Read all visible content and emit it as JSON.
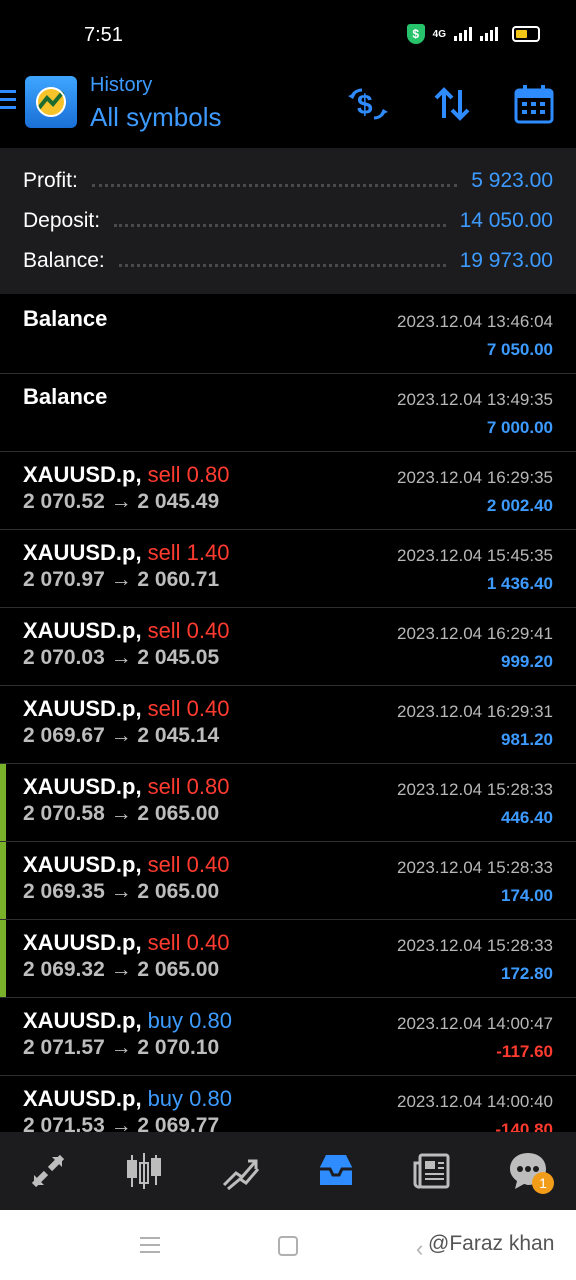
{
  "status": {
    "time": "7:51",
    "network": "4G",
    "shield_glyph": "$"
  },
  "header": {
    "subtitle": "History",
    "title": "All symbols",
    "actions": [
      "currency-exchange-icon",
      "sort-icon",
      "calendar-icon"
    ],
    "accent_color": "#3d9bff"
  },
  "summary": {
    "profit_label": "Profit:",
    "profit_value": "5 923.00",
    "deposit_label": "Deposit:",
    "deposit_value": "14 050.00",
    "balance_label": "Balance:",
    "balance_value": "19 973.00"
  },
  "deals": [
    {
      "kind": "balance",
      "title": "Balance",
      "date": "2023.12.04 13:46:04",
      "profit": "7 050.00"
    },
    {
      "kind": "balance",
      "title": "Balance",
      "date": "2023.12.04 13:49:35",
      "profit": "7 000.00"
    },
    {
      "kind": "trade",
      "symbol": "XAUUSD.p,",
      "side": "sell 0.80",
      "prices": "2 070.52 → 2 045.49",
      "date": "2023.12.04 16:29:35",
      "profit": "2 002.40"
    },
    {
      "kind": "trade",
      "symbol": "XAUUSD.p,",
      "side": "sell 1.40",
      "prices": "2 070.97 → 2 060.71",
      "date": "2023.12.04 15:45:35",
      "profit": "1 436.40"
    },
    {
      "kind": "trade",
      "symbol": "XAUUSD.p,",
      "side": "sell 0.40",
      "prices": "2 070.03 → 2 045.05",
      "date": "2023.12.04 16:29:41",
      "profit": "999.20"
    },
    {
      "kind": "trade",
      "symbol": "XAUUSD.p,",
      "side": "sell 0.40",
      "prices": "2 069.67 → 2 045.14",
      "date": "2023.12.04 16:29:31",
      "profit": "981.20"
    },
    {
      "kind": "trade",
      "symbol": "XAUUSD.p,",
      "side": "sell 0.80",
      "prices": "2 070.58 → 2 065.00",
      "date": "2023.12.04 15:28:33",
      "profit": "446.40"
    },
    {
      "kind": "trade",
      "symbol": "XAUUSD.p,",
      "side": "sell 0.40",
      "prices": "2 069.35 → 2 065.00",
      "date": "2023.12.04 15:28:33",
      "profit": "174.00"
    },
    {
      "kind": "trade",
      "symbol": "XAUUSD.p,",
      "side": "sell 0.40",
      "prices": "2 069.32 → 2 065.00",
      "date": "2023.12.04 15:28:33",
      "profit": "172.80"
    },
    {
      "kind": "trade",
      "symbol": "XAUUSD.p,",
      "side": "buy 0.80",
      "prices": "2 071.57 → 2 070.10",
      "date": "2023.12.04 14:00:47",
      "profit": "-117.60"
    },
    {
      "kind": "trade",
      "symbol": "XAUUSD.p,",
      "side": "buy 0.80",
      "prices": "2 071.53 → 2 069.77",
      "date": "2023.12.04 14:00:40",
      "profit": "-140.80"
    }
  ],
  "bottom_nav": {
    "items": [
      "quotes-icon",
      "chart-icon",
      "trade-icon",
      "history-icon",
      "news-icon",
      "messages-icon"
    ],
    "active": "history-icon",
    "messages_badge": "1"
  },
  "watermark": "@Faraz khan"
}
